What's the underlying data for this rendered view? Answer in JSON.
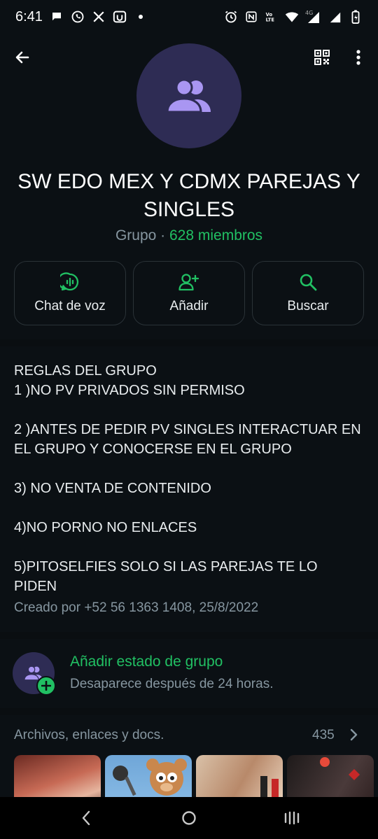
{
  "status_bar": {
    "time": "6:41",
    "network": "4G"
  },
  "group": {
    "name": "SW EDO MEX Y CDMX PAREJAS Y SINGLES",
    "type": "Grupo",
    "separator": " · ",
    "members": "628 miembros"
  },
  "actions": [
    {
      "label": "Chat de voz",
      "icon": "voice-chat-icon"
    },
    {
      "label": "Añadir",
      "icon": "add-person-icon"
    },
    {
      "label": "Buscar",
      "icon": "search-icon"
    }
  ],
  "description": "REGLAS DEL GRUPO\n1 )NO PV PRIVADOS SIN PERMISO\n\n2 )ANTES DE PEDIR PV SINGLES INTERACTUAR EN EL GRUPO Y CONOCERSE EN EL GRUPO\n\n3) NO VENTA DE CONTENIDO\n\n4)NO PORNO NO ENLACES\n\n5)PITOSELFIES SOLO SI LAS PAREJAS TE LO PIDEN",
  "created_by": "Creado por +52 56 1363 1408, 25/8/2022",
  "group_status": {
    "title": "Añadir estado de grupo",
    "subtitle": "Desaparece después de 24 horas."
  },
  "media": {
    "label": "Archivos, enlaces y docs.",
    "count": "435"
  },
  "colors": {
    "accent": "#21c063",
    "background": "#0b1014",
    "avatar_bg": "#2e2c54",
    "avatar_icon": "#a996f2",
    "muted": "#8696a0"
  }
}
